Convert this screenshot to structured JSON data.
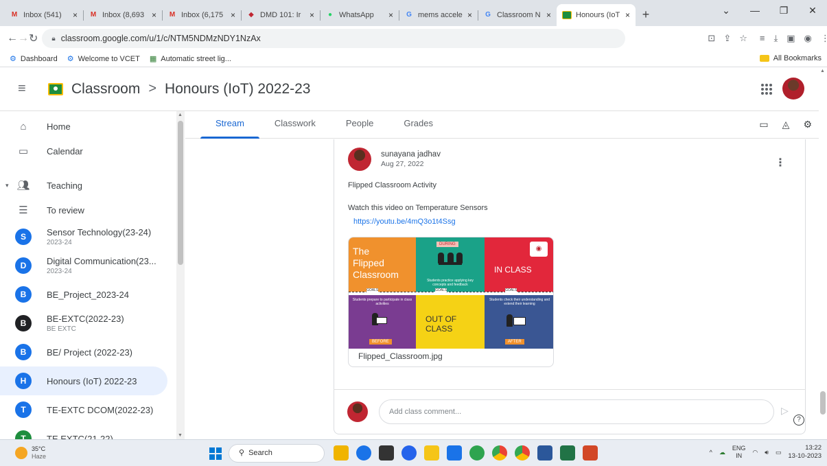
{
  "browser": {
    "tabs": [
      {
        "title": "Inbox (541)",
        "favicon_color": "#d93025",
        "active": false
      },
      {
        "title": "Inbox (8,693",
        "favicon_color": "#d93025",
        "active": false
      },
      {
        "title": "Inbox (6,175",
        "favicon_color": "#d93025",
        "active": false
      },
      {
        "title": "DMD 101: Ir",
        "favicon_color": "#c02632",
        "active": false
      },
      {
        "title": "WhatsApp",
        "favicon_color": "#25d366",
        "active": false
      },
      {
        "title": "mems accele",
        "favicon_color": "#4285f4",
        "active": false
      },
      {
        "title": "Classroom N",
        "favicon_color": "#4285f4",
        "active": false
      },
      {
        "title": "Honours (IoT",
        "favicon_color": "#1e8e3e",
        "active": true
      }
    ],
    "new_tab_label": "+",
    "url": "classroom.google.com/u/1/c/NTM5NDMzNDY1NzAx",
    "bookmarks": [
      "Dashboard",
      "Welcome to VCET",
      "Automatic street lig..."
    ],
    "all_bookmarks": "All Bookmarks"
  },
  "app": {
    "name": "Classroom",
    "class_name": "Honours (IoT) 2022-23",
    "breadcrumb_separator": ">"
  },
  "sidebar": {
    "nav": [
      {
        "label": "Home",
        "icon": "home-icon"
      },
      {
        "label": "Calendar",
        "icon": "calendar-icon"
      }
    ],
    "teaching_label": "Teaching",
    "to_review_label": "To review",
    "courses": [
      {
        "letter": "S",
        "name": "Sensor Technology(23-24)",
        "sub": "2023-24",
        "color": "#1a73e8"
      },
      {
        "letter": "D",
        "name": "Digital Communication(23...",
        "sub": "2023-24",
        "color": "#1a73e8"
      },
      {
        "letter": "B",
        "name": "BE_Project_2023-24",
        "sub": "",
        "color": "#1a73e8"
      },
      {
        "letter": "B",
        "name": "BE-EXTC(2022-23)",
        "sub": "BE EXTC",
        "color": "#202124"
      },
      {
        "letter": "B",
        "name": "BE/ Project (2022-23)",
        "sub": "",
        "color": "#1a73e8"
      },
      {
        "letter": "H",
        "name": "Honours (IoT) 2022-23",
        "sub": "",
        "color": "#1a73e8",
        "active": true
      },
      {
        "letter": "T",
        "name": "TE-EXTC DCOM(2022-23)",
        "sub": "",
        "color": "#1a73e8"
      },
      {
        "letter": "T",
        "name": "TE EXTC(21-22)",
        "sub": "",
        "color": "#1e8e3e"
      }
    ]
  },
  "class_tabs": [
    "Stream",
    "Classwork",
    "People",
    "Grades"
  ],
  "post": {
    "author": "sunayana jadhav",
    "date": "Aug 27, 2022",
    "title": "Flipped Classroom Activity",
    "body": "Watch this video on Temperature Sensors",
    "link": "https://youtu.be/4mQ3o1t4Ssg",
    "attachment": {
      "file_name": "Flipped_Classroom.jpg",
      "thumb_title": [
        "The",
        "Flipped",
        "Classroom"
      ],
      "in_class": "IN CLASS",
      "out_of_class": "OUT OF CLASS",
      "during": "DURING",
      "before": "BEFORE",
      "after": "AFTER",
      "goals": "GOALS",
      "during_text": "Students practice applying key concepts and feedback",
      "before_text": "Students prepare to participate in class activities",
      "after_text": "Students check their understanding and extend their learning"
    }
  },
  "comment": {
    "placeholder": "Add class comment..."
  },
  "taskbar": {
    "temperature": "35°C",
    "weather": "Haze",
    "search_label": "Search",
    "lang_top": "ENG",
    "lang_bottom": "IN",
    "time": "13:22",
    "date": "13-10-2023",
    "apps": [
      "#f0b400",
      "#1a73e8",
      "#333333",
      "#2563eb",
      "#f5c518",
      "#1a73e8",
      "#2ea44f",
      "#e8710a",
      "#1a73e8",
      "#2b579a",
      "#217346",
      "#d24726"
    ]
  }
}
